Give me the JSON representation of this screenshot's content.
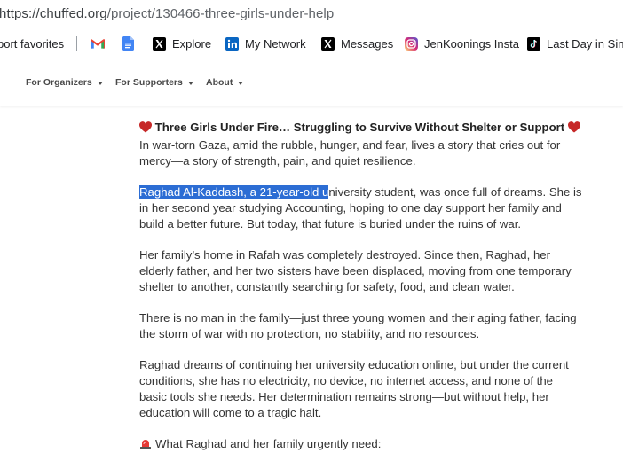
{
  "browser": {
    "url_host": "https://chuffed.org",
    "url_path": "/project/130466-three-girls-under-help"
  },
  "bookmarks": {
    "items": [
      {
        "label": "port favorites",
        "icon": "folder-icon"
      },
      {
        "label": "",
        "icon": "gmail-icon"
      },
      {
        "label": "",
        "icon": "google-docs-icon"
      },
      {
        "label": "Explore",
        "icon": "x-icon"
      },
      {
        "label": "My Network",
        "icon": "linkedin-icon"
      },
      {
        "label": "Messages",
        "icon": "x-icon"
      },
      {
        "label": "JenKoonings Insta",
        "icon": "instagram-icon"
      },
      {
        "label": "Last Day in Singa",
        "icon": "tiktok-icon"
      }
    ]
  },
  "site_nav": {
    "items": [
      {
        "label": "For Organizers"
      },
      {
        "label": "For Supporters"
      },
      {
        "label": "About"
      }
    ]
  },
  "article": {
    "title": "Three Girls Under Fire… Struggling to Survive Without Shelter or Support",
    "intro": "In war-torn Gaza, amid the rubble, hunger, and fear, lives a story that cries out for mercy—a story of strength, pain, and quiet resilience.",
    "p1_highlight": "Raghad Al-Kaddash, a 21-year-old u",
    "p1_rest": "niversity student, was once full of dreams. She is in her second year studying Accounting, hoping to one day support her family and build a better future. But today, that future is buried under the ruins of war.",
    "p2": "Her family’s home in Rafah was completely destroyed. Since then, Raghad, her elderly father, and her two sisters have been displaced, moving from one temporary shelter to another, constantly searching for safety, food, and clean water.",
    "p3": "There is no man in the family—just three young women and their aging father, facing the storm of war with no protection, no stability, and no resources.",
    "p4": "Raghad dreams of continuing her university education online, but under the current conditions, she has no electricity, no device, no internet access, and none of the basic tools she needs. Her determination remains strong—but without help, her education will come to a tragic halt.",
    "needs_heading": "What Raghad and her family urgently need:"
  },
  "colors": {
    "highlight": "#2c6dd4",
    "heart": "#c62828",
    "gmail_red": "#ea4335",
    "docs_blue": "#4285f4",
    "linkedin_blue": "#0a66c2",
    "instagram_pink": "#e1306c"
  }
}
